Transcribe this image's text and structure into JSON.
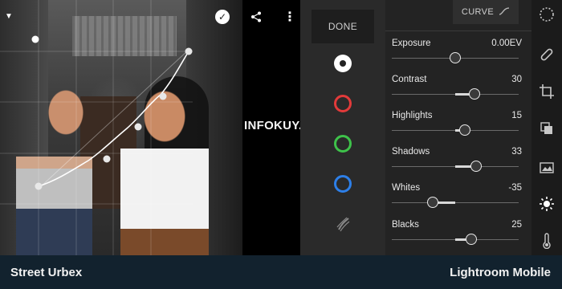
{
  "watermark": "INFOKUY.NET",
  "toolbar_top": {
    "share_icon": "share-icon",
    "more_icon": "more-vertical-icon",
    "confirm_icon": "check-circle-icon"
  },
  "channels": {
    "done_label": "DONE",
    "items": [
      {
        "name": "rgb",
        "color": "#ffffff",
        "selected": true
      },
      {
        "name": "red",
        "color": "#e23a3a"
      },
      {
        "name": "green",
        "color": "#3ec24a"
      },
      {
        "name": "blue",
        "color": "#2d7fe8"
      }
    ],
    "reset_icon": "targeted-adjust-icon"
  },
  "panel": {
    "curve_label": "CURVE",
    "sliders": [
      {
        "label": "Exposure",
        "value": "0.00EV",
        "amount": 0
      },
      {
        "label": "Contrast",
        "value": "30",
        "amount": 30
      },
      {
        "label": "Highlights",
        "value": "15",
        "amount": 15
      },
      {
        "label": "Shadows",
        "value": "33",
        "amount": 33
      },
      {
        "label": "Whites",
        "value": "-35",
        "amount": -35
      },
      {
        "label": "Blacks",
        "value": "25",
        "amount": 25
      }
    ]
  },
  "tools": [
    {
      "name": "presets-icon"
    },
    {
      "name": "healing-icon"
    },
    {
      "name": "crop-icon"
    },
    {
      "name": "profiles-icon"
    },
    {
      "name": "auto-icon"
    },
    {
      "name": "light-icon",
      "active": true
    },
    {
      "name": "color-temperature-icon"
    }
  ],
  "footer": {
    "left": "Street Urbex",
    "right": "Lightroom Mobile"
  },
  "colors": {
    "footer_bg": "#12222e",
    "panel_bg": "#232323"
  }
}
